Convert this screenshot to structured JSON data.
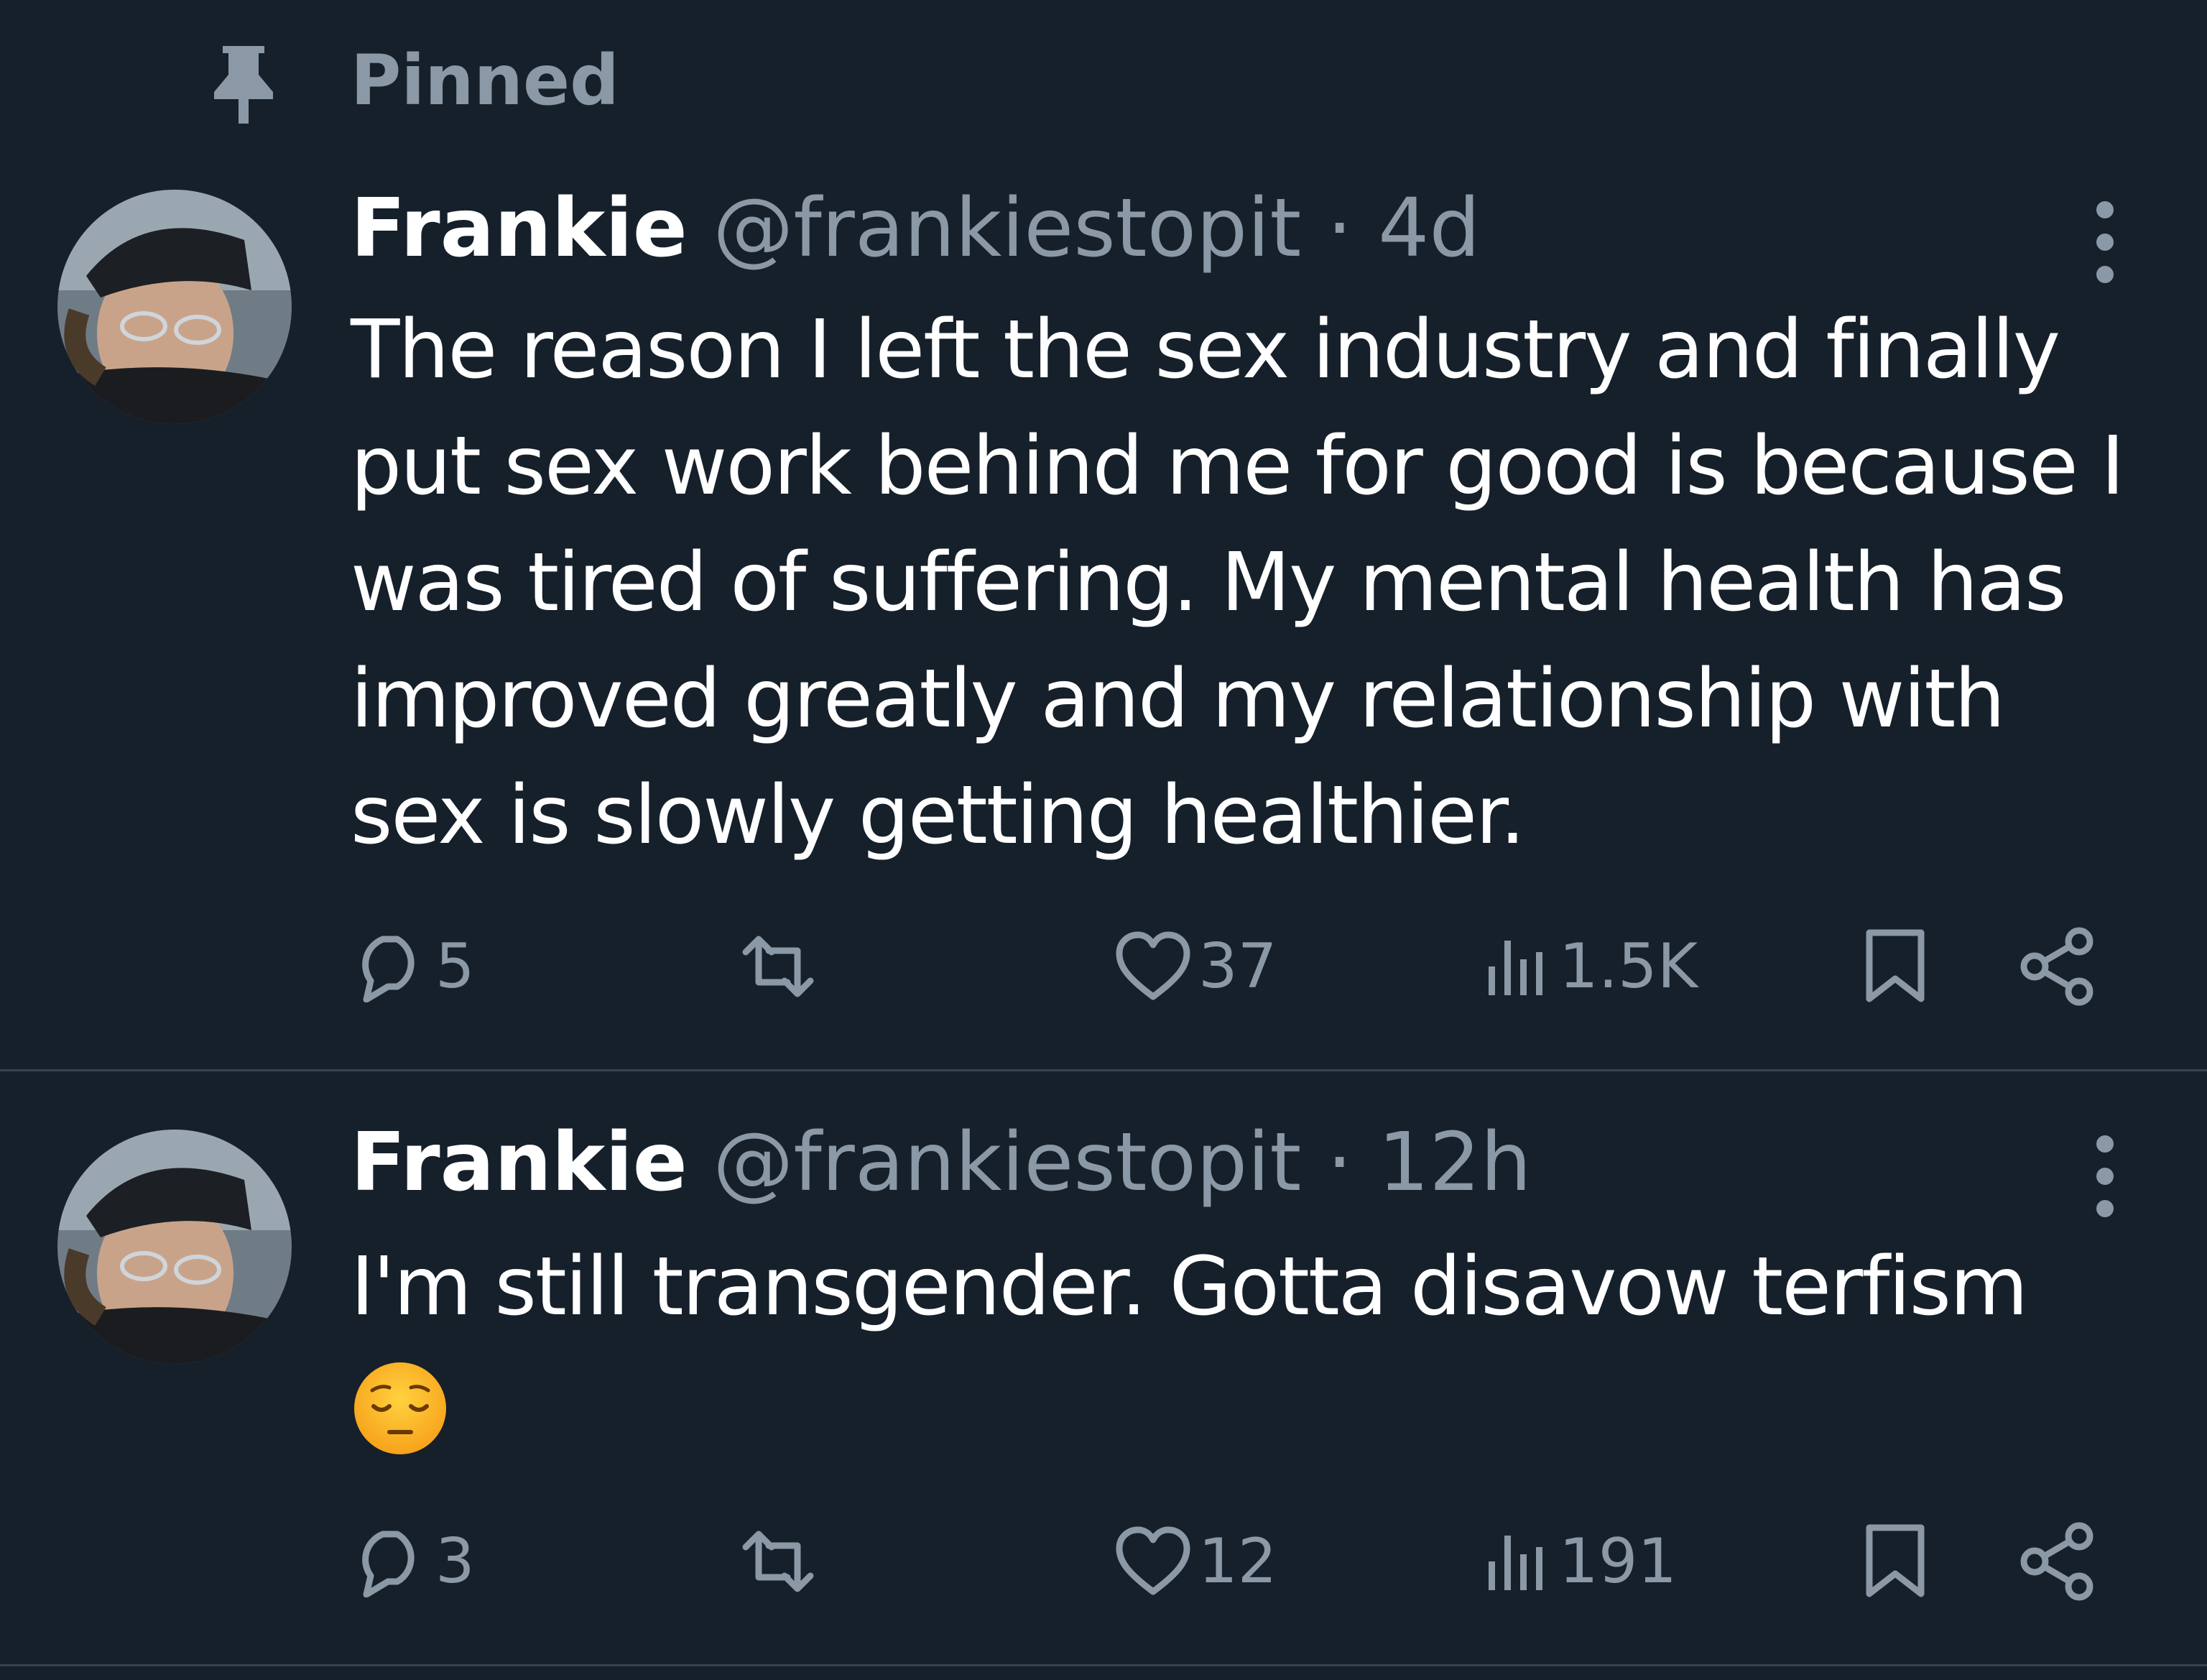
{
  "pinned": {
    "label": "Pinned",
    "icon": "pin-icon"
  },
  "colors": {
    "background": "#15202b",
    "text_primary": "#ffffff",
    "text_secondary": "#8b98a5",
    "divider": "#38444d"
  },
  "tweets": [
    {
      "display_name": "Frankie",
      "handle": "@frankiestopit",
      "separator": "·",
      "timestamp": "4d",
      "text": "The reason I left the sex industry and finally put sex work behind me for good is because I was tired of suffering. My mental health has improved greatly and my relationship with sex is slowly getting healthier.",
      "emoji": "",
      "replies": "5",
      "retweets": "",
      "likes": "37",
      "views": "1.5K"
    },
    {
      "display_name": "Frankie",
      "handle": "@frankiestopit",
      "separator": "·",
      "timestamp": "12h",
      "text": "I'm still transgender. Gotta disavow terfism",
      "emoji": "pensive-face-emoji",
      "replies": "3",
      "retweets": "",
      "likes": "12",
      "views": "191"
    }
  ]
}
